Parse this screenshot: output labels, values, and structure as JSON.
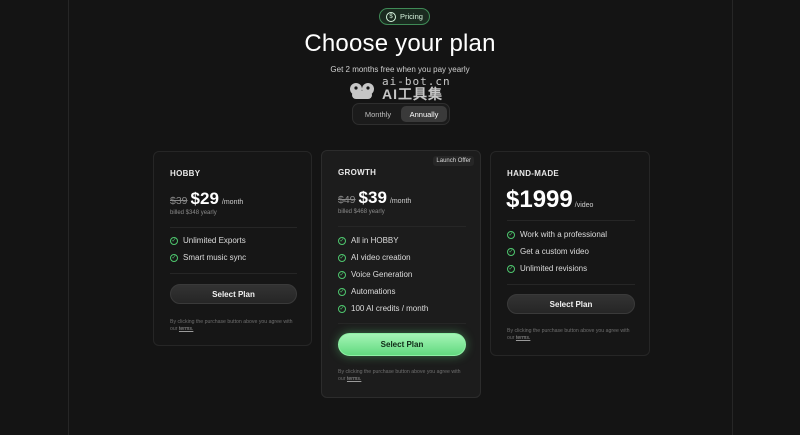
{
  "badge": {
    "label": "Pricing",
    "icon": "dollar-circle-icon",
    "accent": "#3f8a56"
  },
  "header": {
    "title": "Choose your plan",
    "subtitle": "Get 2 months free when you pay yearly"
  },
  "watermark": {
    "top": "ai-bot.cn",
    "bottom": "AI工具集"
  },
  "billing_toggle": {
    "options": [
      "Monthly",
      "Annually"
    ],
    "selected": "Annually"
  },
  "plans": [
    {
      "name": "HOBBY",
      "old_price": "$39",
      "price": "$29",
      "period": "/month",
      "billed": "billed $348 yearly",
      "features": [
        "Unlimited Exports",
        "Smart music sync"
      ],
      "cta": "Select Plan",
      "terms_text": "By clicking the purchase button above you agree with our",
      "terms_link": "terms."
    },
    {
      "name": "GROWTH",
      "badge": "Launch Offer",
      "old_price": "$49",
      "price": "$39",
      "period": "/month",
      "billed": "billed $468 yearly",
      "features": [
        "All in HOBBY",
        "AI video creation",
        "Voice Generation",
        "Automations",
        "100 AI credits / month"
      ],
      "cta": "Select Plan",
      "terms_text": "By clicking the purchase button above you agree with our",
      "terms_link": "terms."
    },
    {
      "name": "HAND-MADE",
      "price": "$1999",
      "period": "/video",
      "features": [
        "Work with a professional",
        "Get a custom video",
        "Unlimited revisions"
      ],
      "cta": "Select Plan",
      "terms_text": "By clicking the purchase button above you agree with our",
      "terms_link": "terms."
    }
  ],
  "colors": {
    "background": "#141414",
    "card": "#161616",
    "card_featured": "#1c1c1c",
    "check": "#4ec76e",
    "primary_button": "#7ee69a"
  }
}
